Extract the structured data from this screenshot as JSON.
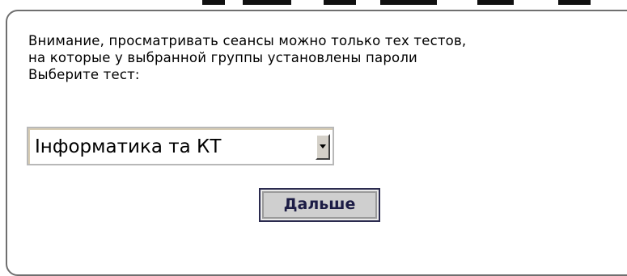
{
  "notice": {
    "line1": "Внимание, просматривать сеансы можно только тех тестов,",
    "line2": "на которые у выбранной группы установлены пароли",
    "line3": "Выберите тест:"
  },
  "test_select": {
    "selected_value": "Інформатика та КТ",
    "arrow_icon": "dropdown-arrow-icon"
  },
  "next_button": {
    "label": "Дальше"
  }
}
